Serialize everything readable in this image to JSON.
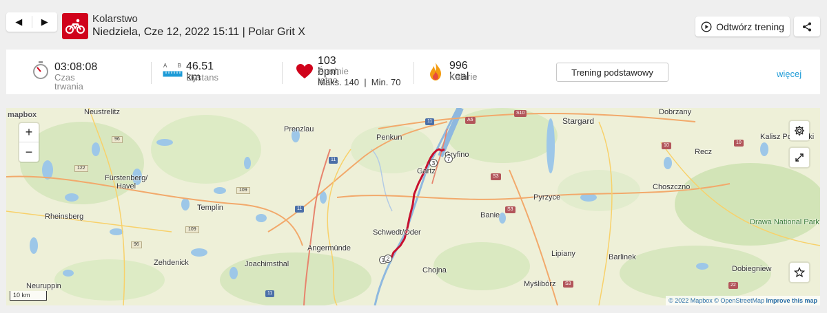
{
  "header": {
    "prev_label": "◀",
    "next_label": "▶",
    "sport": "Kolarstwo",
    "date_device": "Niedziela, Cze 12, 2022 15:11 | Polar Grit X",
    "replay_label": "Odtwórz trening",
    "share_icon": "share-icon"
  },
  "stats": {
    "duration": {
      "value": "03:08:08",
      "label": "Czas trwania",
      "icon": "stopwatch-icon"
    },
    "distance": {
      "value": "46.51 km",
      "label": "Dystans",
      "a": "A",
      "b": "B",
      "icon": "ruler-icon"
    },
    "heart": {
      "value": "103 bpm",
      "label": "Średnie tętno",
      "detail": "Maks. 140  |  Min. 70",
      "icon": "heart-icon",
      "color": "#d0021b"
    },
    "calories": {
      "value": "996 kcal",
      "label": "Kalorie",
      "icon": "flame-icon",
      "color": "#f39c12"
    },
    "training_button": "Trening podstawowy",
    "more_link": "więcej"
  },
  "map": {
    "logo": "mapbox",
    "zoom_in": "+",
    "zoom_out": "−",
    "scale": "10 km",
    "route_color": "#c8102e",
    "markers": [
      "3",
      "7",
      "1",
      "2"
    ],
    "places": [
      "Neustrelitz",
      "Prenzlau",
      "Penkun",
      "Stargard",
      "Dobrzany",
      "Kalisz Pomorski",
      "Recz",
      "Fürstenberg/",
      "Havel",
      "Templin",
      "Rheinsberg",
      "Pyrzyce",
      "Choszczno",
      "Drawa National Park",
      "Banie",
      "Schwedt/Oder",
      "Angermünde",
      "Zehdenick",
      "Joachimsthal",
      "Lipiany",
      "Barlinek",
      "Dobiegniew",
      "Chojna",
      "Myślibórz",
      "Neuruppin",
      "Gryfino",
      "Gartz"
    ],
    "roads": [
      "96",
      "122",
      "109",
      "11",
      "11",
      "11",
      "109",
      "96",
      "11",
      "11",
      "S10",
      "A6",
      "S3",
      "S3",
      "S3",
      "10",
      "10",
      "22"
    ],
    "attribution": {
      "copy": "© 2022 Mapbox",
      "osm": "© OpenStreetMap",
      "improve": "Improve this map"
    }
  }
}
